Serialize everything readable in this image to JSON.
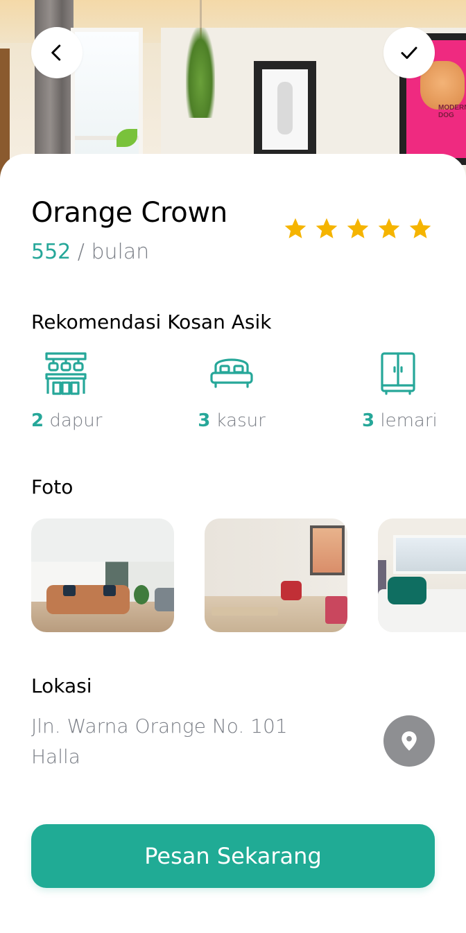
{
  "hero": {
    "poster_text": "MODERN\nDOG",
    "back_icon": "chevron-left-icon",
    "check_icon": "check-icon"
  },
  "listing": {
    "name": "Orange Crown",
    "price": "552",
    "price_unit": " / bulan",
    "rating": 5,
    "rating_max": 5
  },
  "facilities": {
    "heading": "Rekomendasi Kosan Asik",
    "items": [
      {
        "count": "2",
        "label": " dapur",
        "icon": "kitchen-icon"
      },
      {
        "count": "3",
        "label": " kasur",
        "icon": "bed-icon"
      },
      {
        "count": "3",
        "label": " lemari",
        "icon": "wardrobe-icon"
      }
    ]
  },
  "photos": {
    "heading": "Foto"
  },
  "location": {
    "heading": "Lokasi",
    "address_line1": "Jln. Warna Orange No. 101",
    "address_line2": "Halla",
    "icon": "map-pin-icon"
  },
  "cta": {
    "label": "Pesan Sekarang"
  },
  "colors": {
    "accent": "#20ab95",
    "star": "#f5b400",
    "muted": "#7a7e86"
  }
}
